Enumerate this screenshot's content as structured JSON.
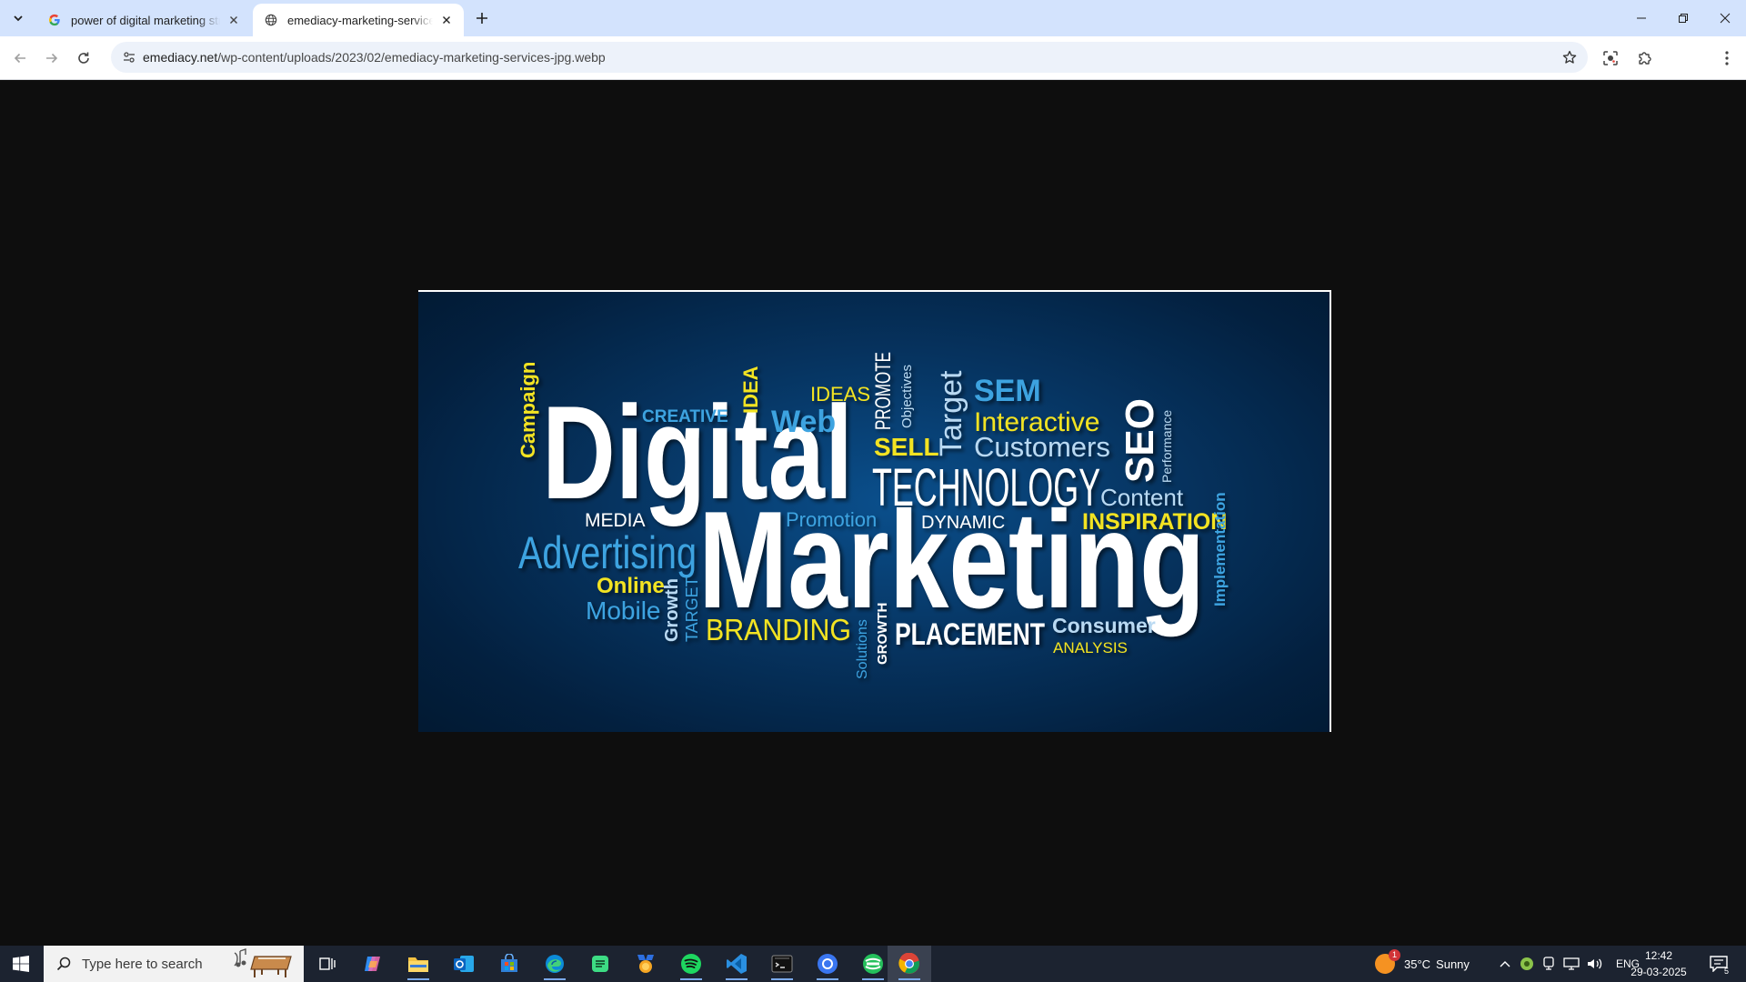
{
  "browser": {
    "tabs": [
      {
        "title": "power of digital marketing strategies",
        "favicon": "google-g-icon",
        "active": false
      },
      {
        "title": "emediacy-marketing-services-jpg.webp",
        "favicon": "globe-icon",
        "active": true
      }
    ],
    "url_domain": "emediacy.net",
    "url_path": "/wp-content/uploads/2023/02/emediacy-marketing-services-jpg.webp"
  },
  "image": {
    "words": {
      "digital": "Digital",
      "marketing": "Marketing",
      "campaign": "Campaign",
      "creative": "CREATIVE",
      "idea": "IDEA",
      "ideas": "IDEAS",
      "web": "Web",
      "promote": "PROMOTE",
      "objectives": "Objectives",
      "target_v": "Target",
      "sem": "SEM",
      "interactive": "Interactive",
      "customers": "Customers",
      "seo": "SEO",
      "performance": "Performance",
      "sell": "SELL",
      "technology": "TECHNOLOGY",
      "content": "Content",
      "media": "MEDIA",
      "promotion": "Promotion",
      "dynamic": "DYNAMIC",
      "inspiration": "INSPIRATION",
      "advertising": "Advertising",
      "implementation": "Implementation",
      "online": "Online",
      "mobile": "Mobile",
      "growth_v": "Growth",
      "target_caps": "TARGET",
      "branding": "BRANDING",
      "solutions": "Solutions",
      "growth_caps": "GROWTH",
      "placement": "PLACEMENT",
      "consumer": "Consumer",
      "analysis": "ANALYSIS"
    },
    "colors": {
      "white": "#ffffff",
      "yellow": "#f3e320",
      "blue": "#3ea3e0",
      "lightblue": "#b9d9f2"
    }
  },
  "taskbar": {
    "search_placeholder": "Type here to search",
    "weather": {
      "temp": "35°C",
      "condition": "Sunny",
      "badge": "1"
    },
    "language": "ENG",
    "time": "12:42",
    "date": "29-03-2025",
    "notification_count": "5",
    "apps": [
      "task-view-icon",
      "copilot-icon",
      "file-explorer-icon",
      "outlook-icon",
      "microsoft-store-icon",
      "edge-icon",
      "android-studio-icon",
      "medal-icon",
      "spotify-icon",
      "vscode-icon",
      "terminal-icon",
      "signal-icon",
      "browser-icon",
      "chrome-icon"
    ]
  }
}
